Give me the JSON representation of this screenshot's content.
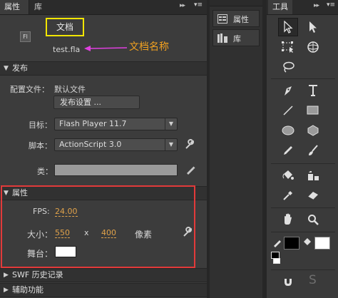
{
  "left_panel": {
    "tabs": [
      "属性",
      "库"
    ],
    "document": {
      "type_icon_text": "Fl",
      "title": "文档",
      "filename": "test.fla",
      "annotation": "文档名称"
    },
    "publish": {
      "header": "发布",
      "profile_label": "配置文件：",
      "profile_value": "默认文件",
      "settings_button": "发布设置 ...",
      "target_label": "目标：",
      "target_value": "Flash Player 11.7",
      "script_label": "脚本：",
      "script_value": "ActionScript 3.0",
      "class_label": "类："
    },
    "properties": {
      "header": "属性",
      "fps_label": "FPS:",
      "fps_value": "24.00",
      "size_label": "大小：",
      "width": "550",
      "times": "x",
      "height": "400",
      "unit": "像素",
      "stage_label": "舞台：",
      "stage_color": "#ffffff"
    },
    "swf_history": {
      "header": "SWF 历史记录"
    },
    "helper": {
      "header": "辅助功能"
    }
  },
  "middle_panel": {
    "items": [
      {
        "label": "属性",
        "icon": "properties-icon"
      },
      {
        "label": "库",
        "icon": "library-icon"
      }
    ]
  },
  "tools_panel": {
    "title": "工具",
    "tools": [
      "selection-tool-icon",
      "subselection-tool-icon",
      "free-transform-tool-icon",
      "3d-rotation-tool-icon",
      "lasso-tool-icon",
      "pen-tool-icon",
      "text-tool-icon",
      "line-tool-icon",
      "rectangle-tool-icon",
      "oval-tool-icon",
      "polystar-tool-icon",
      "pencil-tool-icon",
      "brush-tool-icon",
      "paint-bucket-tool-icon",
      "ink-bottle-tool-icon",
      "eyedropper-tool-icon",
      "eraser-tool-icon",
      "hand-tool-icon",
      "zoom-tool-icon"
    ],
    "stroke_color": "#000000",
    "fill_color": "#ffffff"
  },
  "colors": {
    "highlight_yellow": "#f2e600",
    "highlight_red": "#e23a3a",
    "annotation_magenta": "#e040e0",
    "annotation_orange": "#f0a020",
    "value_orange": "#e0a24a"
  }
}
